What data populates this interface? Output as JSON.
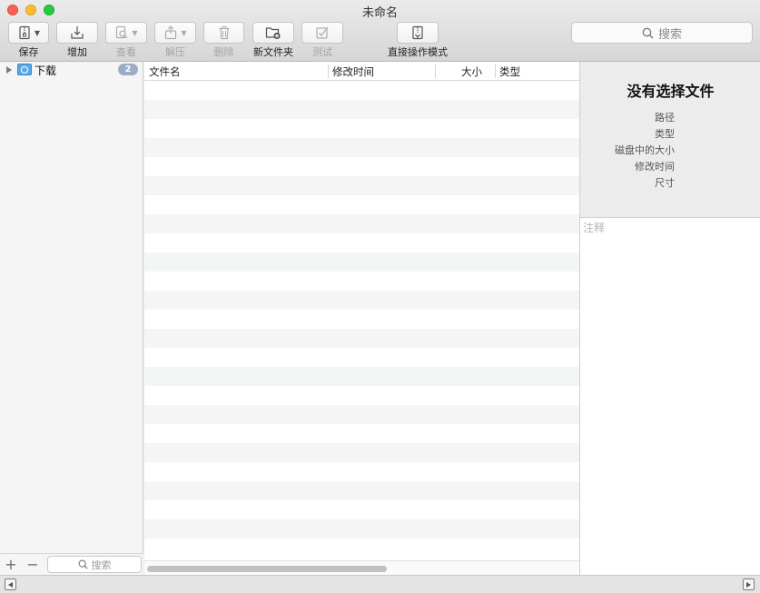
{
  "window": {
    "title": "未命名"
  },
  "toolbar": {
    "buttons": [
      {
        "label": "保存",
        "icon": "archive-save-icon",
        "enabled": true,
        "menu": true
      },
      {
        "label": "增加",
        "icon": "add-tray-icon",
        "enabled": true,
        "menu": false
      },
      {
        "label": "查看",
        "icon": "quicklook-icon",
        "enabled": false,
        "menu": true
      },
      {
        "label": "解压",
        "icon": "extract-icon",
        "enabled": false,
        "menu": true
      },
      {
        "label": "删除",
        "icon": "trash-icon",
        "enabled": false,
        "menu": false
      },
      {
        "label": "新文件夹",
        "icon": "new-folder-icon",
        "enabled": true,
        "menu": false
      },
      {
        "label": "测试",
        "icon": "test-check-icon",
        "enabled": false,
        "menu": false
      },
      {
        "label": "直接操作模式",
        "icon": "direct-mode-icon",
        "enabled": true,
        "menu": false
      }
    ],
    "search_placeholder": "搜索"
  },
  "sidebar": {
    "items": [
      {
        "label": "下载",
        "count": "2",
        "icon": "downloads-folder-icon"
      }
    ],
    "add_symbol": "+",
    "remove_symbol": "−",
    "search_placeholder": "搜索"
  },
  "filelist": {
    "columns": [
      "文件名",
      "修改时间",
      "大小",
      "类型"
    ],
    "rows": []
  },
  "info": {
    "title": "没有选择文件",
    "fields": [
      "路径",
      "类型",
      "磁盘中的大小",
      "修改时间",
      "尺寸"
    ],
    "notes_placeholder": "注释"
  },
  "colors": {
    "selection_badge": "#9cabc7",
    "folder": "#5aa9e6"
  }
}
